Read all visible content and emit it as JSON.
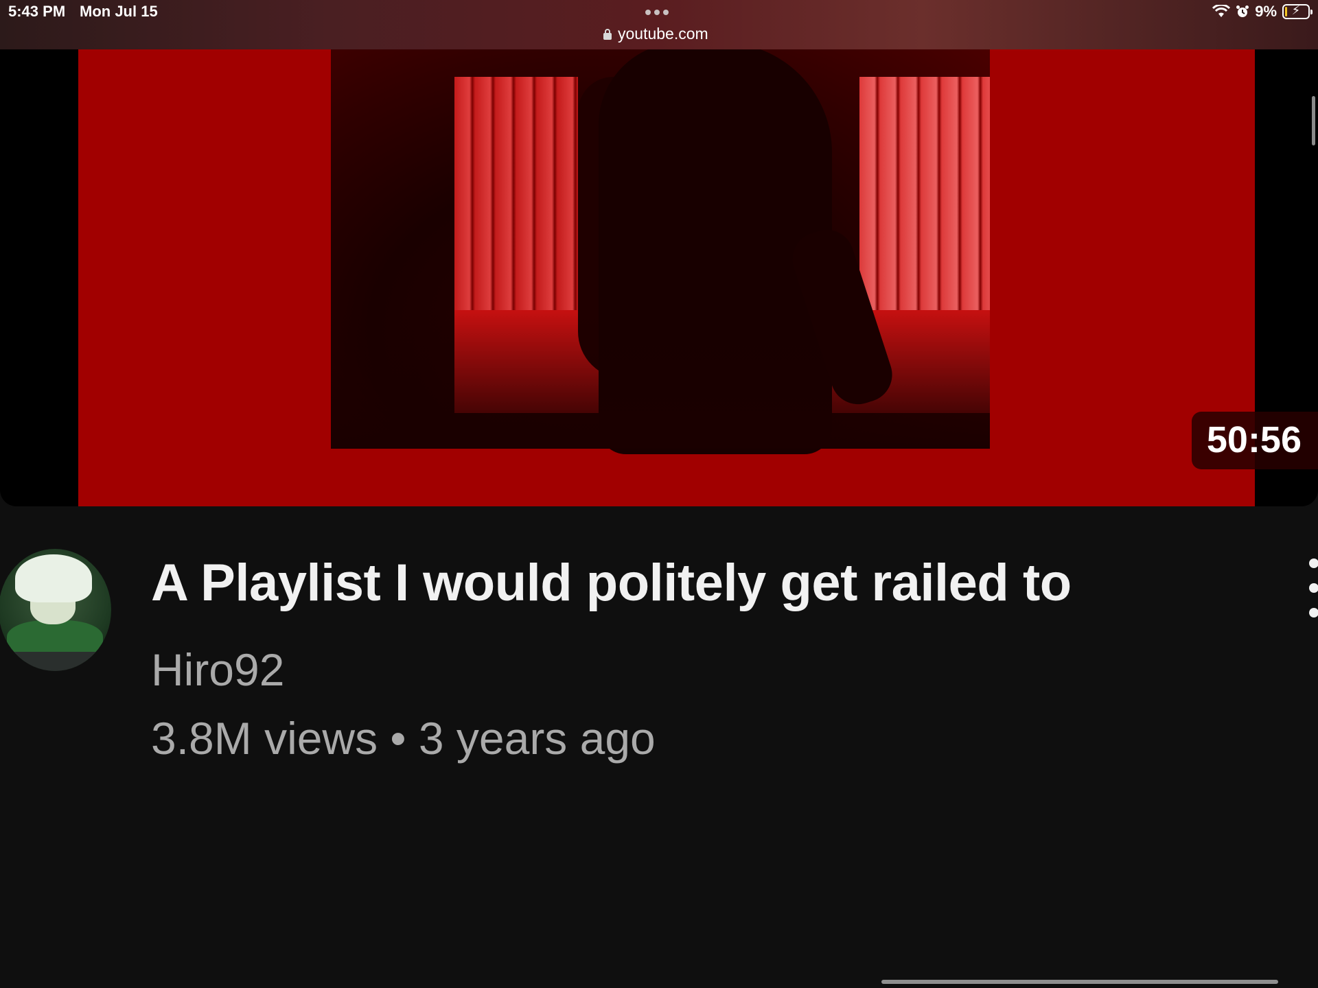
{
  "status_bar": {
    "time": "5:43 PM",
    "date": "Mon Jul 15",
    "url": "youtube.com",
    "battery_percent_label": "9%",
    "battery_level": 0.09,
    "icons": [
      "wifi-icon",
      "alarm-icon",
      "battery-charging-icon",
      "lock-icon",
      "more-dots-icon"
    ]
  },
  "video": {
    "duration": "50:56",
    "title": "A Playlist I would politely get railed to",
    "channel": "Hiro92",
    "stats": "3.8M views • 3 years ago"
  },
  "colors": {
    "background": "#0f0f0f",
    "thumbnail_red": "#a10000",
    "title_text": "#f1f1f1",
    "secondary_text": "#aaaaaa"
  }
}
